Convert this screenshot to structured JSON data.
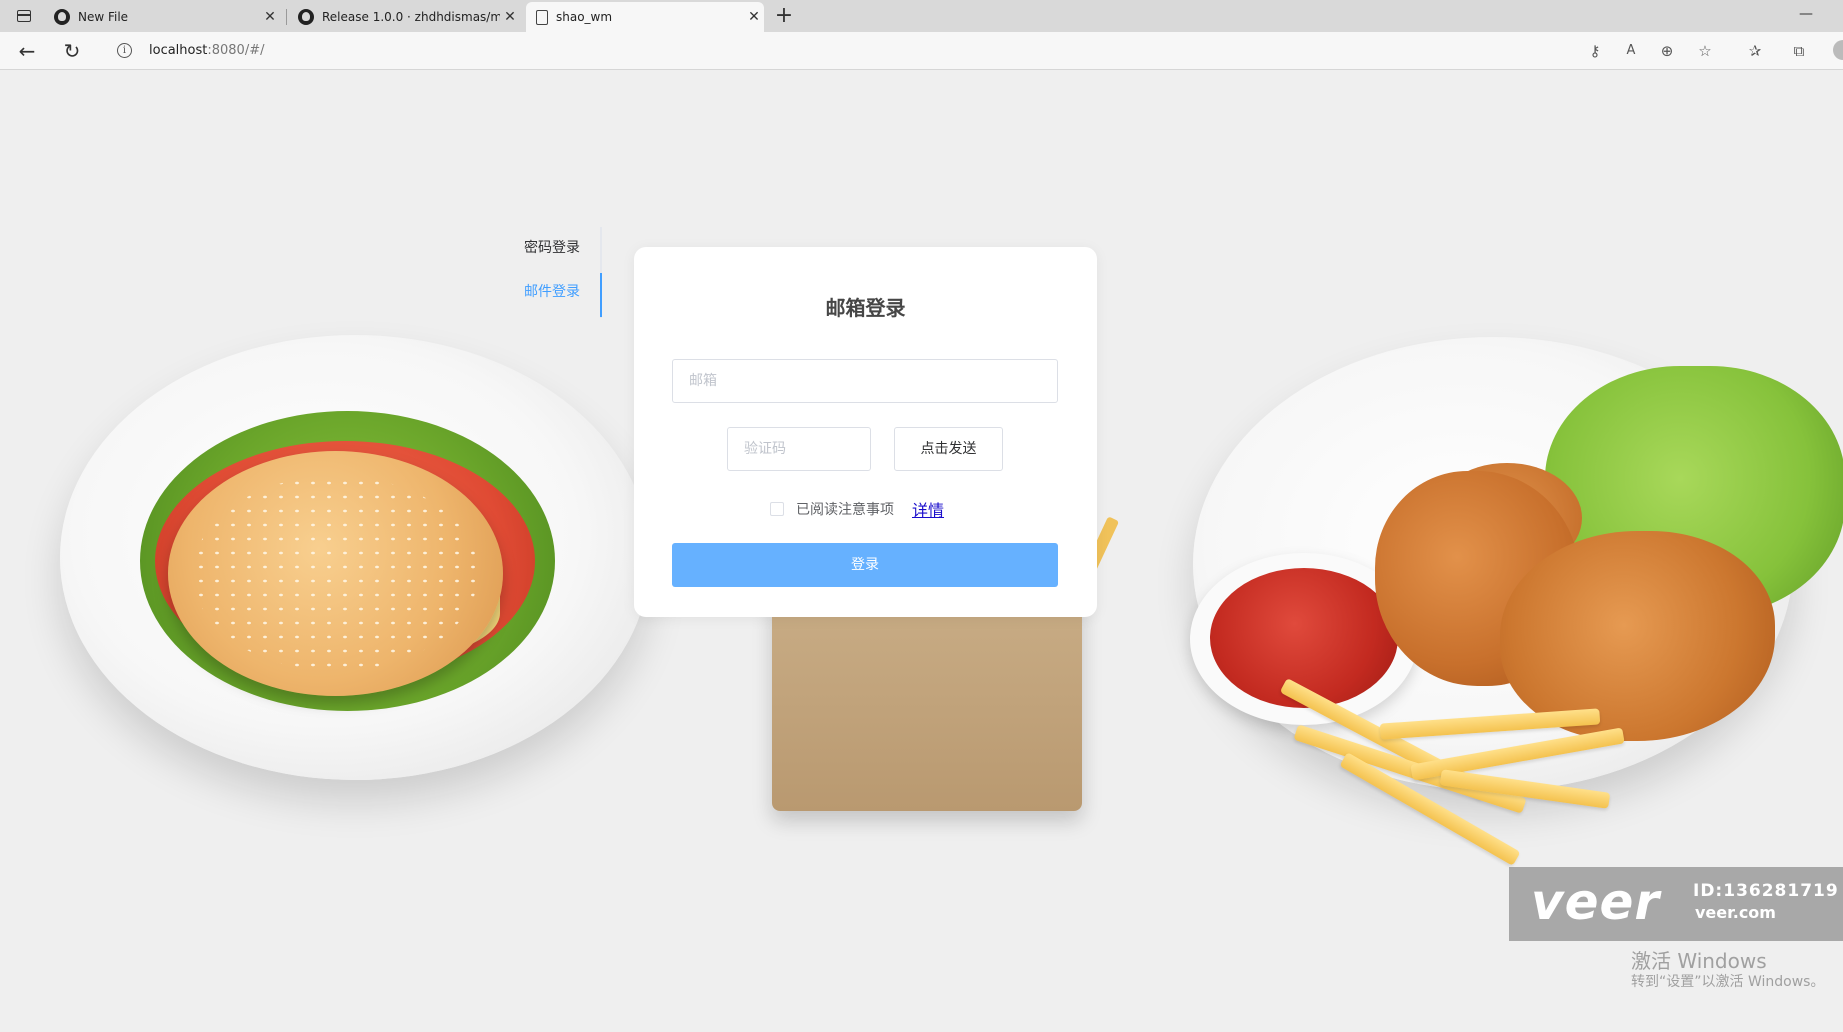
{
  "browser": {
    "tabs": [
      {
        "title": "New File",
        "icon": "github-icon",
        "active": false
      },
      {
        "title": "Release 1.0.0 · zhdhdismas/musi",
        "icon": "github-icon",
        "active": false
      },
      {
        "title": "shao_wm",
        "icon": "page-icon",
        "active": true
      }
    ],
    "close_glyph": "✕",
    "new_tab_glyph": "+",
    "minimize_glyph": "—",
    "url_host": "localhost",
    "url_rest": ":8080/#/"
  },
  "login_tabs": [
    {
      "label": "密码登录",
      "active": false
    },
    {
      "label": "邮件登录",
      "active": true
    }
  ],
  "form": {
    "title": "邮箱登录",
    "email_placeholder": "邮箱",
    "code_placeholder": "验证码",
    "send_label": "点击发送",
    "agree_label": "已阅读注意事项",
    "detail_link": "详情",
    "login_label": "登录"
  },
  "watermark": {
    "logo": "veer",
    "id": "ID:136281719",
    "site": "veer.com"
  },
  "windows_activation": {
    "line1": "激活 Windows",
    "line2": "转到“设置”以激活 Windows。"
  },
  "colors": {
    "accent": "#409eff",
    "login_button": "#66b1ff",
    "link": "#1a0dcc",
    "background": "#efefef"
  }
}
